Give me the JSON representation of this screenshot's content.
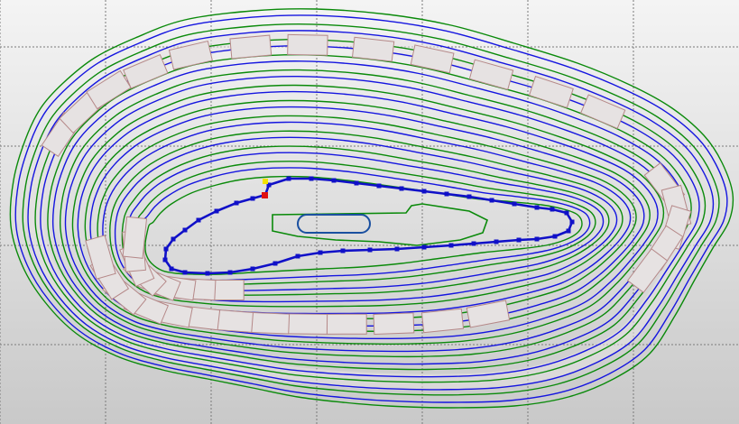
{
  "view": {
    "background_top": "#f4f4f4",
    "background_bottom": "#c9c9c9",
    "grid_color": "#7a7a7a"
  },
  "pit": {
    "bench_count": 12,
    "colors": {
      "bench_crest": "#0a8a0a",
      "bench_toe": "#1515e0",
      "road_segment": "#b58888",
      "road_fill": "#e6e2e2",
      "haul_route": "#1010c8",
      "marker_start": "#e01010",
      "marker_end": "#f2e200",
      "pit_floor": "#0a8a0a",
      "sump": "#1a50a0"
    }
  }
}
